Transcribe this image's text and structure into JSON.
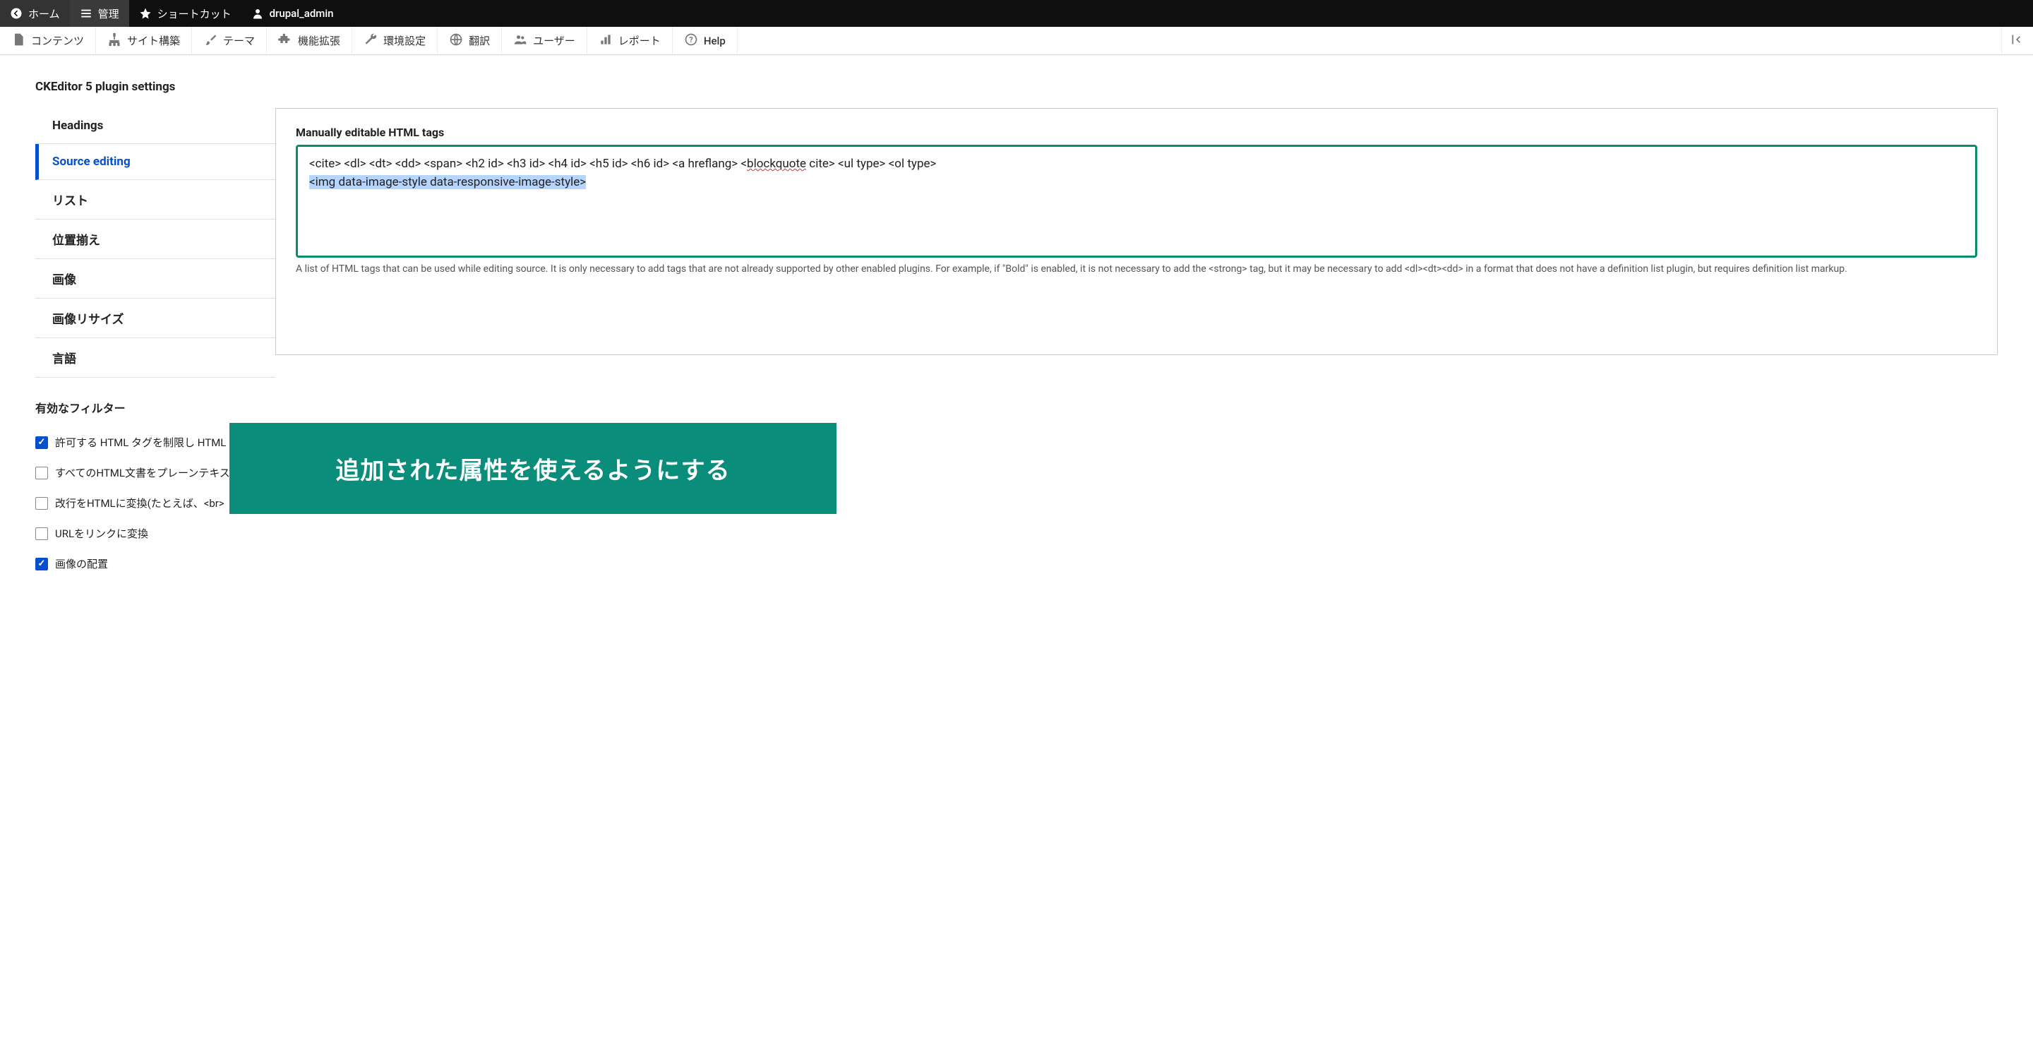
{
  "topbar": {
    "home": "ホーム",
    "manage": "管理",
    "shortcuts": "ショートカット",
    "user": "drupal_admin"
  },
  "admin_menu": {
    "content": "コンテンツ",
    "structure": "サイト構築",
    "appearance": "テーマ",
    "extend": "機能拡張",
    "config": "環境設定",
    "translate": "翻訳",
    "people": "ユーザー",
    "reports": "レポート",
    "help": "Help"
  },
  "section_title": "CKEditor 5 plugin settings",
  "vtabs": [
    {
      "label": "Headings",
      "active": false
    },
    {
      "label": "Source editing",
      "active": true
    },
    {
      "label": "リスト",
      "active": false
    },
    {
      "label": "位置揃え",
      "active": false
    },
    {
      "label": "画像",
      "active": false
    },
    {
      "label": "画像リサイズ",
      "active": false
    },
    {
      "label": "言語",
      "active": false
    }
  ],
  "panel": {
    "field_label": "Manually editable HTML tags",
    "textarea_line1": "<cite> <dl> <dt> <dd> <span> <h2 id> <h3 id> <h4 id> <h5 id> <h6 id> <a hreflang> <",
    "textarea_spell": "blockquote",
    "textarea_line1b": " cite> <ul type> <ol type>",
    "textarea_line2": "<img data-image-style data-responsive-image-style>",
    "help_text": "A list of HTML tags that can be used while editing source. It is only necessary to add tags that are not already supported by other enabled plugins. For example, if \"Bold\" is enabled, it is not necessary to add the <strong> tag, but it may be necessary to add <dl><dt><dd> in a format that does not have a definition list plugin, but requires definition list markup."
  },
  "filters": {
    "title": "有効なフィルター",
    "items": [
      {
        "label": "許可する HTML タグを制限し HTML",
        "checked": true
      },
      {
        "label": "すべてのHTML文書をプレーンテキス",
        "checked": false
      },
      {
        "label": "改行をHTMLに変換(たとえば、<br>",
        "checked": false
      },
      {
        "label": "URLをリンクに変換",
        "checked": false
      },
      {
        "label": "画像の配置",
        "checked": true
      }
    ]
  },
  "overlay_text": "追加された属性を使えるようにする"
}
